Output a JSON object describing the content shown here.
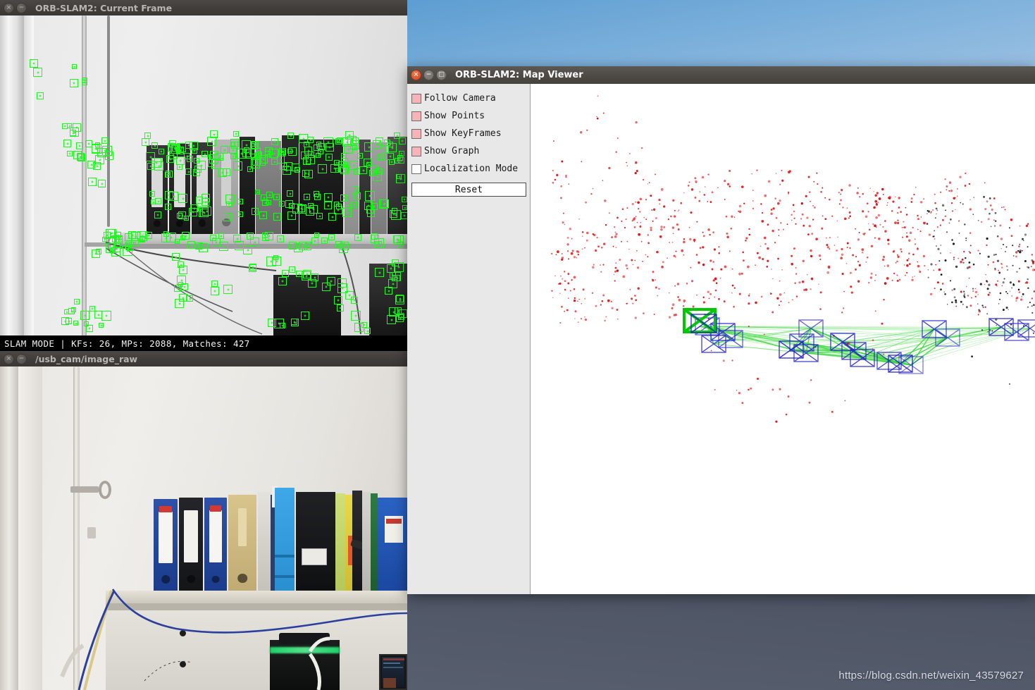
{
  "windows": {
    "current_frame": {
      "title": "ORB-SLAM2: Current Frame",
      "status": "SLAM MODE |  KFs: 26, MPs: 2088, Matches: 427",
      "controls": {
        "close": "×",
        "minimize": "−"
      }
    },
    "raw_cam": {
      "title": "/usb_cam/image_raw",
      "controls": {
        "close": "×",
        "minimize": "−"
      }
    },
    "map_viewer": {
      "title": "ORB-SLAM2: Map Viewer",
      "controls": {
        "close": "×",
        "minimize": "−",
        "maximize": "□"
      },
      "checkboxes": [
        {
          "label": "Follow Camera",
          "checked": true
        },
        {
          "label": "Show Points",
          "checked": true
        },
        {
          "label": "Show KeyFrames",
          "checked": true
        },
        {
          "label": "Show Graph",
          "checked": true
        },
        {
          "label": "Localization Mode",
          "checked": false
        }
      ],
      "reset_label": "Reset"
    }
  },
  "slam_stats": {
    "mode": "SLAM MODE",
    "keyframes": 26,
    "map_points": 2088,
    "matches": 427
  },
  "colors": {
    "checkbox_checked": "#f7b3b6",
    "checkbox_unchecked": "#ffffff",
    "panel_bg": "#e8e8e8",
    "map_bg": "#ffffff",
    "orb_feature": "#16ff16",
    "map_point_recent": "#e01010",
    "map_point_old": "#111111",
    "keyframe": "#2222cc",
    "current_camera": "#00dd00",
    "covisibility_graph": "#44dd44",
    "titlebar_active": "#4e4b47",
    "titlebar_inactive": "#403d3b"
  },
  "watermark": "https://blog.csdn.net/weixin_43579627",
  "icons": {
    "close": "close-icon",
    "minimize": "minimize-icon",
    "maximize": "maximize-icon"
  }
}
